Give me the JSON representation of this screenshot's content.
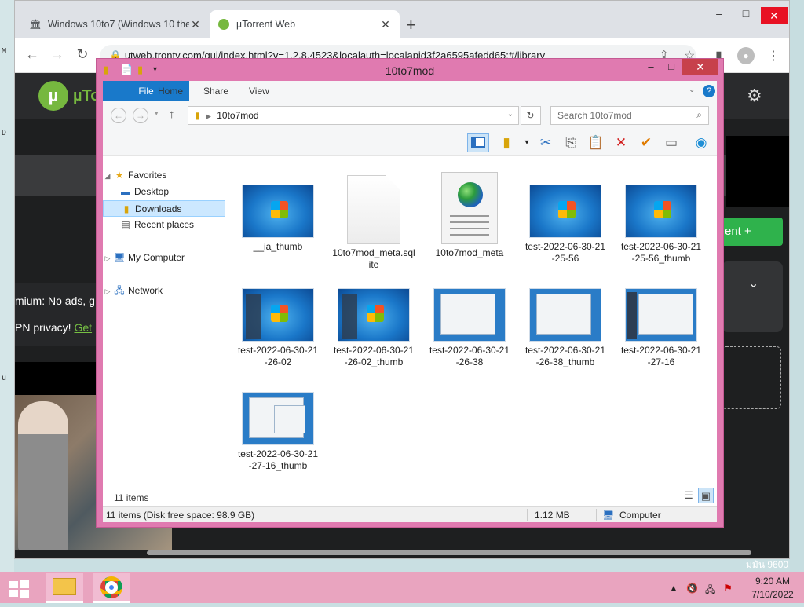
{
  "desktop": {
    "left_glyphs": [
      "M",
      "D",
      "u"
    ],
    "right_watermark": "มมัน 9600"
  },
  "browser": {
    "tabs": [
      {
        "title": "Windows 10to7 (Windows 10 the",
        "icon": "archive-icon"
      },
      {
        "title": "µTorrent Web",
        "icon": "utorrent-icon"
      }
    ],
    "new_tab": "+",
    "url": "utweb.tronty.com/gui/index.html?v=1.2.8.4523&localauth=localapid3f2a6595afedd65:#/library",
    "window_controls": {
      "minimize": "–",
      "maximize": "□",
      "close": "✕"
    }
  },
  "utorrent": {
    "logo": "µ",
    "brand": "µTo",
    "promo_line1": "mium: No ads, g",
    "promo_line2": "PN privacy!",
    "promo_link": "Get",
    "green_button": "ent +",
    "chevron": "⌄"
  },
  "explorer": {
    "title": "10to7mod",
    "ribbon_tabs": [
      "File",
      "Home",
      "Share",
      "View"
    ],
    "address": "10to7mod",
    "search_placeholder": "Search 10to7mod",
    "nav": {
      "favorites": "Favorites",
      "desktop": "Desktop",
      "downloads": "Downloads",
      "recent": "Recent places",
      "computer": "My Computer",
      "network": "Network"
    },
    "files": [
      {
        "name": "__ia_thumb",
        "type": "win7"
      },
      {
        "name": "10to7mod_meta.sqlite",
        "type": "blank"
      },
      {
        "name": "10to7mod_meta",
        "type": "html"
      },
      {
        "name": "test-2022-06-30-21-25-56",
        "type": "win7"
      },
      {
        "name": "test-2022-06-30-21-25-56_thumb",
        "type": "win7"
      },
      {
        "name": "test-2022-06-30-21-26-02",
        "type": "win7"
      },
      {
        "name": "test-2022-06-30-21-26-02_thumb",
        "type": "win7"
      },
      {
        "name": "test-2022-06-30-21-26-38",
        "type": "shot"
      },
      {
        "name": "test-2022-06-30-21-26-38_thumb",
        "type": "shot"
      },
      {
        "name": "test-2022-06-30-21-27-16",
        "type": "shot"
      },
      {
        "name": "test-2022-06-30-21-27-16_thumb",
        "type": "shot"
      }
    ],
    "item_count": "11 items",
    "status_left": "11 items (Disk free space: 98.9 GB)",
    "status_size": "1.12 MB",
    "status_location": "Computer"
  },
  "taskbar": {
    "time": "9:20 AM",
    "date": "7/10/2022"
  },
  "colors": {
    "explorer_frame": "#e07ab0",
    "taskbar": "#e9a4bf",
    "file_tab": "#1979ca",
    "close_red": "#c7414b",
    "utorrent_green": "#76b83f"
  }
}
